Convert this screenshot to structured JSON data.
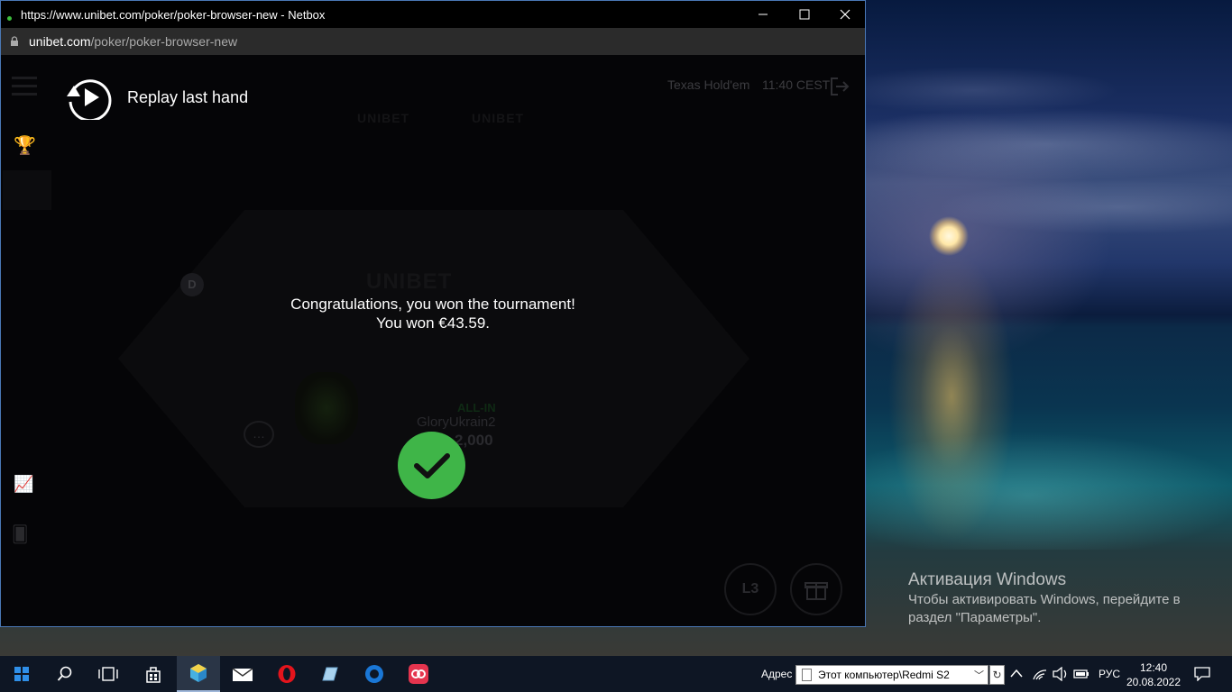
{
  "window": {
    "title": "https://www.unibet.com/poker/poker-browser-new - Netbox",
    "address_host": "unibet.com",
    "address_path": "/poker/poker-browser-new"
  },
  "game": {
    "variant": "Texas Hold'em",
    "time": "11:40 CEST",
    "brand": "UNIBET",
    "dealer_button": "D",
    "all_in_label": "ALL-IN",
    "player_name": "GloryUkrain2",
    "player_chips": "2,000",
    "level_button": "L3",
    "chat_glyph": "…"
  },
  "overlay": {
    "replay_label": "Replay last hand",
    "congrats_line1": "Congratulations, you won the tournament!",
    "congrats_line2": "You won €43.59."
  },
  "desktop": {
    "activation_title": "Активация Windows",
    "activation_line1": "Чтобы активировать Windows, перейдите в",
    "activation_line2": "раздел \"Параметры\"."
  },
  "taskbar": {
    "address_label": "Адрес",
    "address_value": "Этот компьютер\\Redmi S2",
    "language": "РУС",
    "time": "12:40",
    "date": "20.08.2022"
  },
  "colors": {
    "accent_green": "#3fb548",
    "window_border": "#4a78b6",
    "taskbar_bg": "#0e1624"
  }
}
